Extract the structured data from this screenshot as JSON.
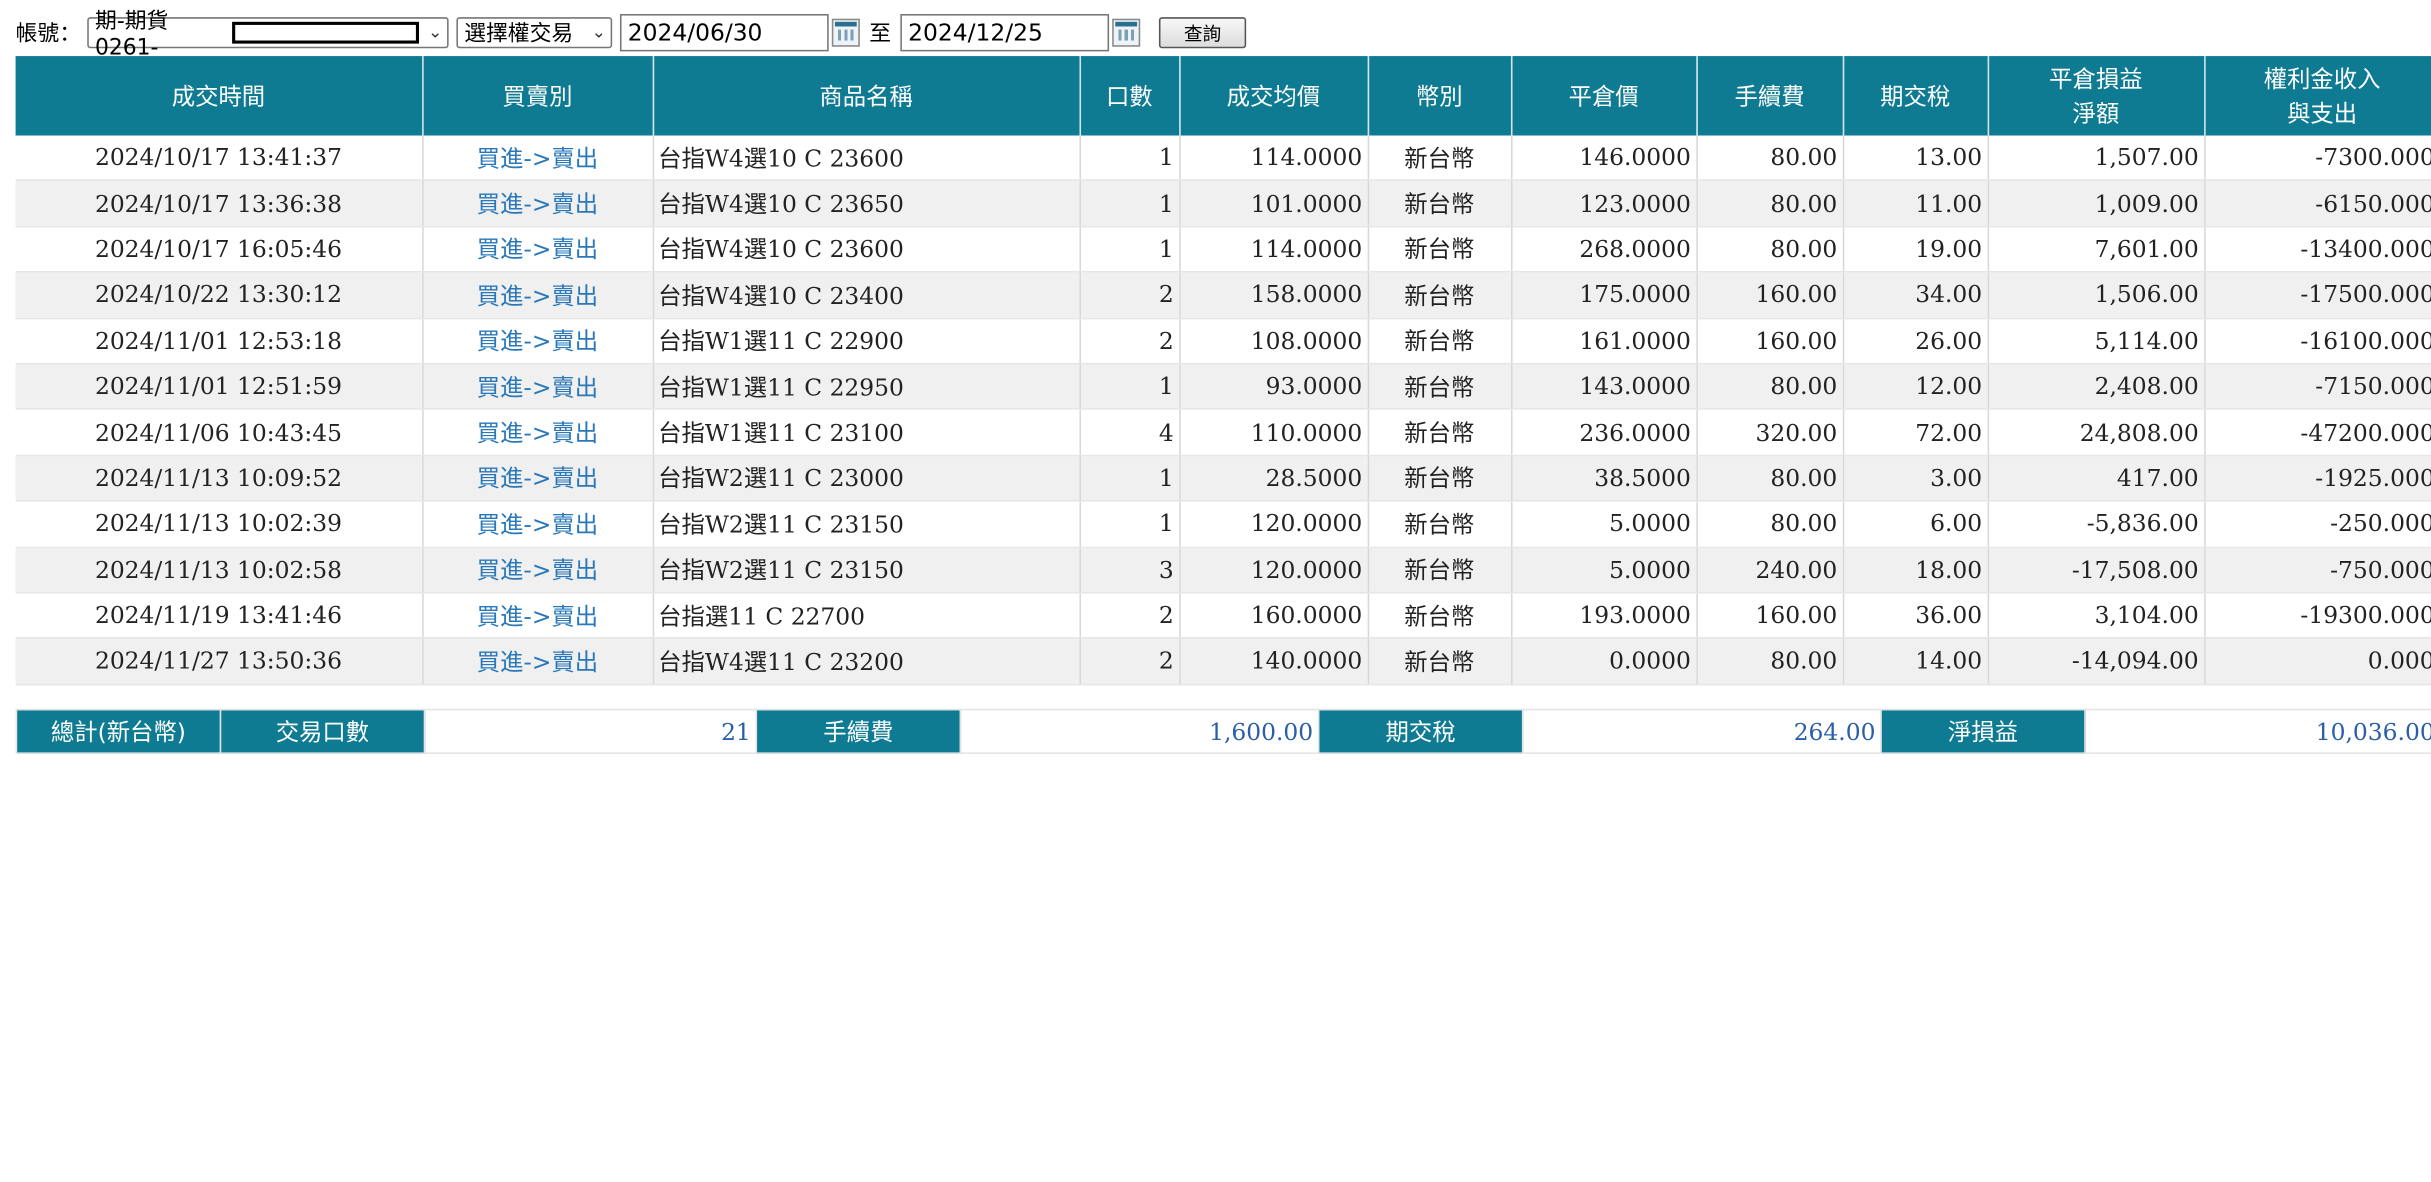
{
  "filter": {
    "account_label": "帳號：",
    "account_value": "期-期貨0261-",
    "trade_type": "選擇權交易",
    "start_date": "2024/06/30",
    "to_label": "至",
    "end_date": "2024/12/25",
    "query_button": "查詢"
  },
  "table": {
    "headers": {
      "time": "成交時間",
      "side": "買賣別",
      "product": "商品名稱",
      "qty": "口數",
      "avg_price": "成交均價",
      "currency": "幣別",
      "close_price": "平倉價",
      "fee": "手續費",
      "tax": "期交稅",
      "pnl_l1": "平倉損益",
      "pnl_l2": "淨額",
      "premium_l1": "權利金收入",
      "premium_l2": "與支出"
    },
    "rows": [
      {
        "time": "2024/10/17 13:41:37",
        "side": "買進->賣出",
        "product": "台指W4選10 C 23600",
        "qty": "1",
        "avg_price": "114.0000",
        "currency": "新台幣",
        "close_price": "146.0000",
        "fee": "80.00",
        "tax": "13.00",
        "pnl": "1,507.00",
        "premium": "-7300.000"
      },
      {
        "time": "2024/10/17 13:36:38",
        "side": "買進->賣出",
        "product": "台指W4選10 C 23650",
        "qty": "1",
        "avg_price": "101.0000",
        "currency": "新台幣",
        "close_price": "123.0000",
        "fee": "80.00",
        "tax": "11.00",
        "pnl": "1,009.00",
        "premium": "-6150.000"
      },
      {
        "time": "2024/10/17 16:05:46",
        "side": "買進->賣出",
        "product": "台指W4選10 C 23600",
        "qty": "1",
        "avg_price": "114.0000",
        "currency": "新台幣",
        "close_price": "268.0000",
        "fee": "80.00",
        "tax": "19.00",
        "pnl": "7,601.00",
        "premium": "-13400.000"
      },
      {
        "time": "2024/10/22 13:30:12",
        "side": "買進->賣出",
        "product": "台指W4選10 C 23400",
        "qty": "2",
        "avg_price": "158.0000",
        "currency": "新台幣",
        "close_price": "175.0000",
        "fee": "160.00",
        "tax": "34.00",
        "pnl": "1,506.00",
        "premium": "-17500.000"
      },
      {
        "time": "2024/11/01 12:53:18",
        "side": "買進->賣出",
        "product": "台指W1選11 C 22900",
        "qty": "2",
        "avg_price": "108.0000",
        "currency": "新台幣",
        "close_price": "161.0000",
        "fee": "160.00",
        "tax": "26.00",
        "pnl": "5,114.00",
        "premium": "-16100.000"
      },
      {
        "time": "2024/11/01 12:51:59",
        "side": "買進->賣出",
        "product": "台指W1選11 C 22950",
        "qty": "1",
        "avg_price": "93.0000",
        "currency": "新台幣",
        "close_price": "143.0000",
        "fee": "80.00",
        "tax": "12.00",
        "pnl": "2,408.00",
        "premium": "-7150.000"
      },
      {
        "time": "2024/11/06 10:43:45",
        "side": "買進->賣出",
        "product": "台指W1選11 C 23100",
        "qty": "4",
        "avg_price": "110.0000",
        "currency": "新台幣",
        "close_price": "236.0000",
        "fee": "320.00",
        "tax": "72.00",
        "pnl": "24,808.00",
        "premium": "-47200.000"
      },
      {
        "time": "2024/11/13 10:09:52",
        "side": "買進->賣出",
        "product": "台指W2選11 C 23000",
        "qty": "1",
        "avg_price": "28.5000",
        "currency": "新台幣",
        "close_price": "38.5000",
        "fee": "80.00",
        "tax": "3.00",
        "pnl": "417.00",
        "premium": "-1925.000"
      },
      {
        "time": "2024/11/13 10:02:39",
        "side": "買進->賣出",
        "product": "台指W2選11 C 23150",
        "qty": "1",
        "avg_price": "120.0000",
        "currency": "新台幣",
        "close_price": "5.0000",
        "fee": "80.00",
        "tax": "6.00",
        "pnl": "-5,836.00",
        "premium": "-250.000"
      },
      {
        "time": "2024/11/13 10:02:58",
        "side": "買進->賣出",
        "product": "台指W2選11 C 23150",
        "qty": "3",
        "avg_price": "120.0000",
        "currency": "新台幣",
        "close_price": "5.0000",
        "fee": "240.00",
        "tax": "18.00",
        "pnl": "-17,508.00",
        "premium": "-750.000"
      },
      {
        "time": "2024/11/19 13:41:46",
        "side": "買進->賣出",
        "product": "台指選11 C 22700",
        "qty": "2",
        "avg_price": "160.0000",
        "currency": "新台幣",
        "close_price": "193.0000",
        "fee": "160.00",
        "tax": "36.00",
        "pnl": "3,104.00",
        "premium": "-19300.000"
      },
      {
        "time": "2024/11/27 13:50:36",
        "side": "買進->賣出",
        "product": "台指W4選11 C 23200",
        "qty": "2",
        "avg_price": "140.0000",
        "currency": "新台幣",
        "close_price": "0.0000",
        "fee": "80.00",
        "tax": "14.00",
        "pnl": "-14,094.00",
        "premium": "0.000"
      }
    ]
  },
  "summary": {
    "total_label": "總計(新台幣)",
    "qty_label": "交易口數",
    "qty_value": "21",
    "fee_label": "手續費",
    "fee_value": "1,600.00",
    "tax_label": "期交稅",
    "tax_value": "264.00",
    "net_label": "淨損益",
    "net_value": "10,036.00"
  },
  "colors": {
    "header_bg": "#0e7b93",
    "link": "#2a78b8",
    "summary_value": "#2a5fa8"
  }
}
